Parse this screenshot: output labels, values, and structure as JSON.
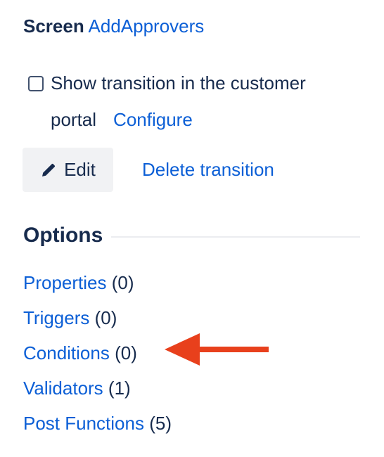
{
  "screen": {
    "label": "Screen",
    "name": "AddApprovers"
  },
  "portal": {
    "checked": false,
    "text_line1": "Show transition in the customer",
    "text_line2": "portal",
    "configure_label": "Configure"
  },
  "actions": {
    "edit_label": "Edit",
    "delete_label": "Delete transition"
  },
  "options": {
    "heading": "Options",
    "items": [
      {
        "label": "Properties",
        "count": "(0)"
      },
      {
        "label": "Triggers",
        "count": "(0)"
      },
      {
        "label": "Conditions",
        "count": "(0)"
      },
      {
        "label": "Validators",
        "count": "(1)"
      },
      {
        "label": "Post Functions",
        "count": "(5)"
      }
    ]
  },
  "annotation": {
    "arrow_color": "#e8401c",
    "points_to": "Conditions"
  },
  "colors": {
    "link": "#0c5fd6",
    "text": "#172b4d",
    "button_bg": "#f1f2f4"
  },
  "icons": {
    "edit": "pencil-icon"
  }
}
